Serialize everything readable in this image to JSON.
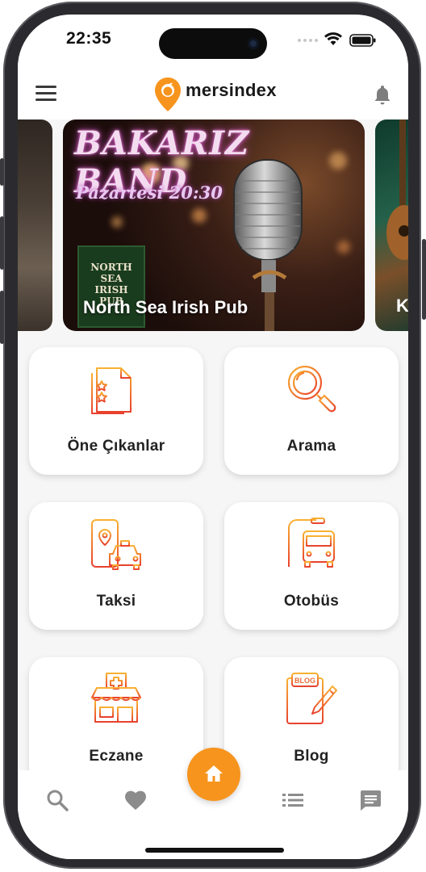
{
  "status_bar": {
    "time": "22:35"
  },
  "header": {
    "logo_text": "mersindex",
    "menu_icon": "hamburger-menu-icon",
    "notification_icon": "bell-icon",
    "brand_color": "#f7941d"
  },
  "banner": {
    "title": "BAKARIZ BAND",
    "subtitle": "Pazartesi 20:30",
    "pub_logo_text": "NORTH SEA IRISH PUB",
    "caption": "North Sea Irish Pub",
    "next_card_caption": "K"
  },
  "tiles": [
    {
      "label": "Öne Çıkanlar",
      "icon": "featured-list-icon"
    },
    {
      "label": "Arama",
      "icon": "magnifier-icon"
    },
    {
      "label": "Taksi",
      "icon": "taxi-icon"
    },
    {
      "label": "Otobüs",
      "icon": "bus-icon"
    },
    {
      "label": "Eczane",
      "icon": "pharmacy-icon"
    },
    {
      "label": "Blog",
      "icon": "blog-icon"
    }
  ],
  "blog_icon_text": "BLOG",
  "bottom_nav": {
    "items": [
      "search-icon",
      "heart-icon",
      "home-icon",
      "list-icon",
      "chat-icon"
    ],
    "active": "home-icon",
    "accent_color": "#f7941d"
  }
}
